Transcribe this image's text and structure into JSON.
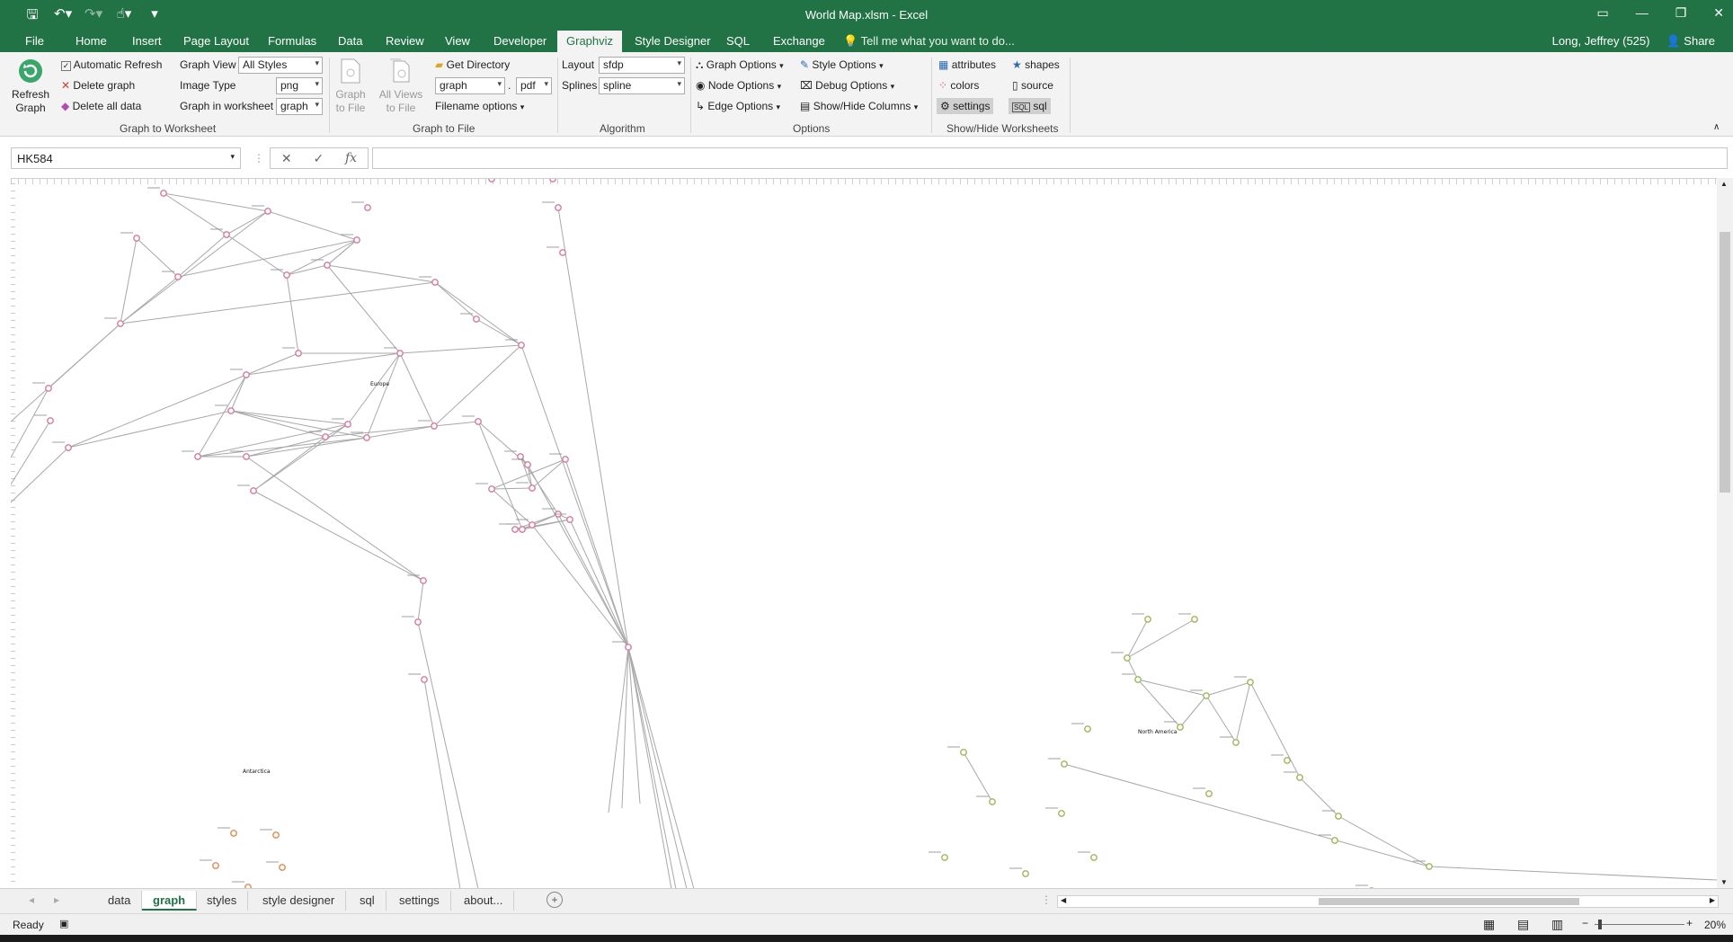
{
  "window": {
    "title": "World Map.xlsm - Excel",
    "user": "Long, Jeffrey (525)",
    "share_label": "Share",
    "tell_me": "Tell me what you want to do..."
  },
  "tabs": [
    "File",
    "Home",
    "Insert",
    "Page Layout",
    "Formulas",
    "Data",
    "Review",
    "View",
    "Developer",
    "Graphviz",
    "Style Designer",
    "SQL",
    "Exchange"
  ],
  "active_tab": "Graphviz",
  "ribbon": {
    "refresh_label_1": "Refresh",
    "refresh_label_2": "Graph",
    "automatic_refresh": "Automatic Refresh",
    "delete_graph": "Delete graph",
    "delete_all_data": "Delete all data",
    "graph_view_label": "Graph View",
    "graph_view_value": "All Styles",
    "image_type_label": "Image Type",
    "image_type_value": "png",
    "graph_in_worksheet_label": "Graph in worksheet",
    "graph_in_worksheet_value": "graph",
    "group_graph_to_worksheet": "Graph to Worksheet",
    "graph_to_file_1": "Graph",
    "graph_to_file_2": "to File",
    "all_views_1": "All Views",
    "all_views_2": "to File",
    "get_directory": "Get Directory",
    "filename_value": "graph",
    "file_ext_value": "pdf",
    "filename_options": "Filename options",
    "group_graph_to_file": "Graph to File",
    "layout_label": "Layout",
    "layout_value": "sfdp",
    "splines_label": "Splines",
    "splines_value": "spline",
    "group_algorithm": "Algorithm",
    "graph_options": "Graph Options",
    "node_options": "Node Options",
    "edge_options": "Edge Options",
    "style_options": "Style Options",
    "debug_options": "Debug Options",
    "show_hide_columns": "Show/Hide Columns",
    "group_options": "Options",
    "attributes": "attributes",
    "colors": "colors",
    "settings": "settings",
    "shapes": "shapes",
    "source": "source",
    "sql": "sql",
    "group_show_hide": "Show/Hide Worksheets"
  },
  "formula_bar": {
    "name_box": "HK584",
    "fx": "fx",
    "content": ""
  },
  "graph_labels": {
    "europe": "Europe",
    "north_america": "North America",
    "antarctica": "Antarctica"
  },
  "sheet_tabs": [
    "data",
    "graph",
    "styles",
    "style designer",
    "sql",
    "settings",
    "about..."
  ],
  "active_sheet": "graph",
  "status": {
    "ready": "Ready",
    "zoom": "20%"
  },
  "colors": {
    "excel_green": "#217346",
    "europe_node": "#d77a9e",
    "north_america_node": "#9cb85a",
    "antarctica_node": "#e08a50",
    "edge": "#a8a8a8"
  }
}
